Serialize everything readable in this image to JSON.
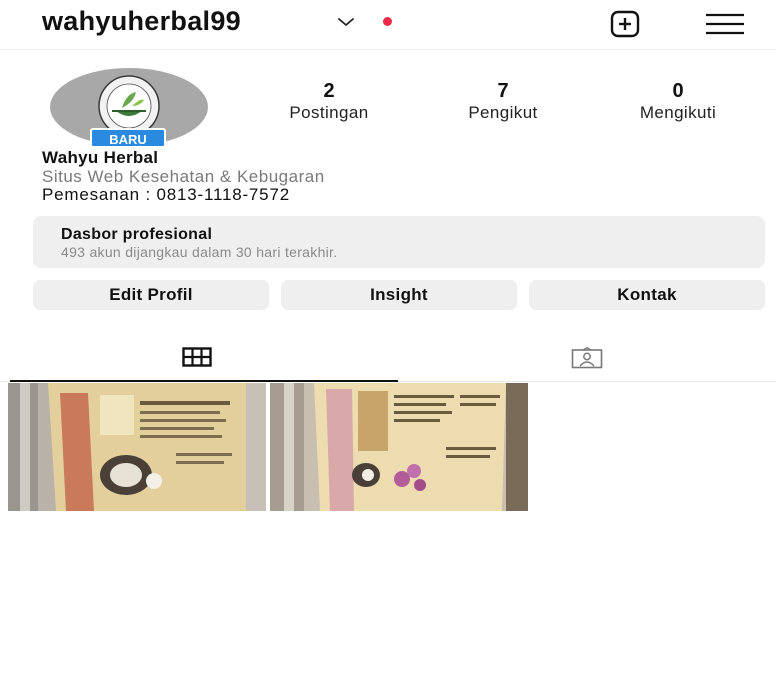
{
  "header": {
    "username": "wahyuherbal99"
  },
  "profile": {
    "badge": "BARU",
    "display_name": "Wahyu Herbal",
    "category": "Situs Web Kesehatan & Kebugaran",
    "bio": "Pemesanan : 0813-1118-7572"
  },
  "stats": [
    {
      "value": "2",
      "label": "Postingan"
    },
    {
      "value": "7",
      "label": "Pengikut"
    },
    {
      "value": "0",
      "label": "Mengikuti"
    }
  ],
  "dashboard": {
    "title": "Dasbor profesional",
    "subtitle": "493 akun dijangkau dalam 30 hari terakhir."
  },
  "buttons": {
    "edit": "Edit Profil",
    "insight": "Insight",
    "contact": "Kontak"
  },
  "tabs": {
    "active": "posts-grid",
    "icons": [
      "grid-icon",
      "tagged-person-icon"
    ]
  },
  "colors": {
    "notification_dot": "#ed2a4a",
    "badge": "#2a8ae0",
    "button_bg": "#efefef"
  }
}
